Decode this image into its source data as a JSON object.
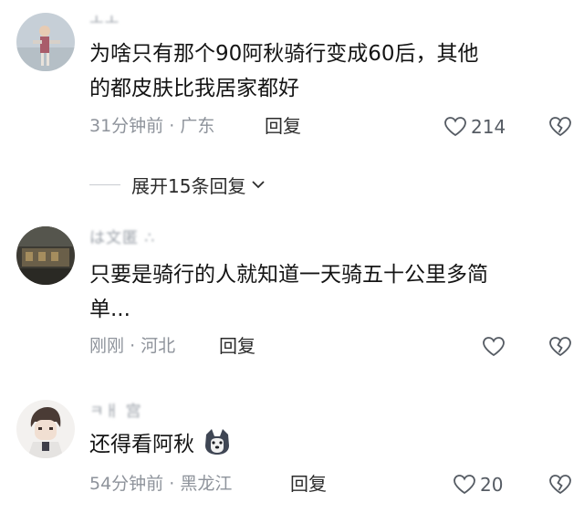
{
  "comments": [
    {
      "username": "ㅗㅗ",
      "content_line1": "为啥只有那个90阿秋骑行变成60后，其他",
      "content_line2": "的都皮肤比我居家都好",
      "time": "31分钟前",
      "location": "广东",
      "reply_label": "回复",
      "likes": "214"
    },
    {
      "username": "は文匿 ∴",
      "content_line1": "只要是骑行的人就知道一天骑五十公里多简",
      "content_line2": "单...",
      "time": "刚刚",
      "location": "河北",
      "reply_label": "回复",
      "likes": ""
    },
    {
      "username": "ㅋㅐ 宫",
      "content_line1": "还得看阿秋",
      "time": "54分钟前",
      "location": "黑龙江",
      "reply_label": "回复",
      "likes": "20",
      "emoji": "husky-face-icon"
    }
  ],
  "expand_replies": {
    "label": "展开15条回复"
  },
  "meta_separator": "·",
  "colors": {
    "text": "#141414",
    "meta": "#8e939b",
    "icon": "#555b63"
  }
}
